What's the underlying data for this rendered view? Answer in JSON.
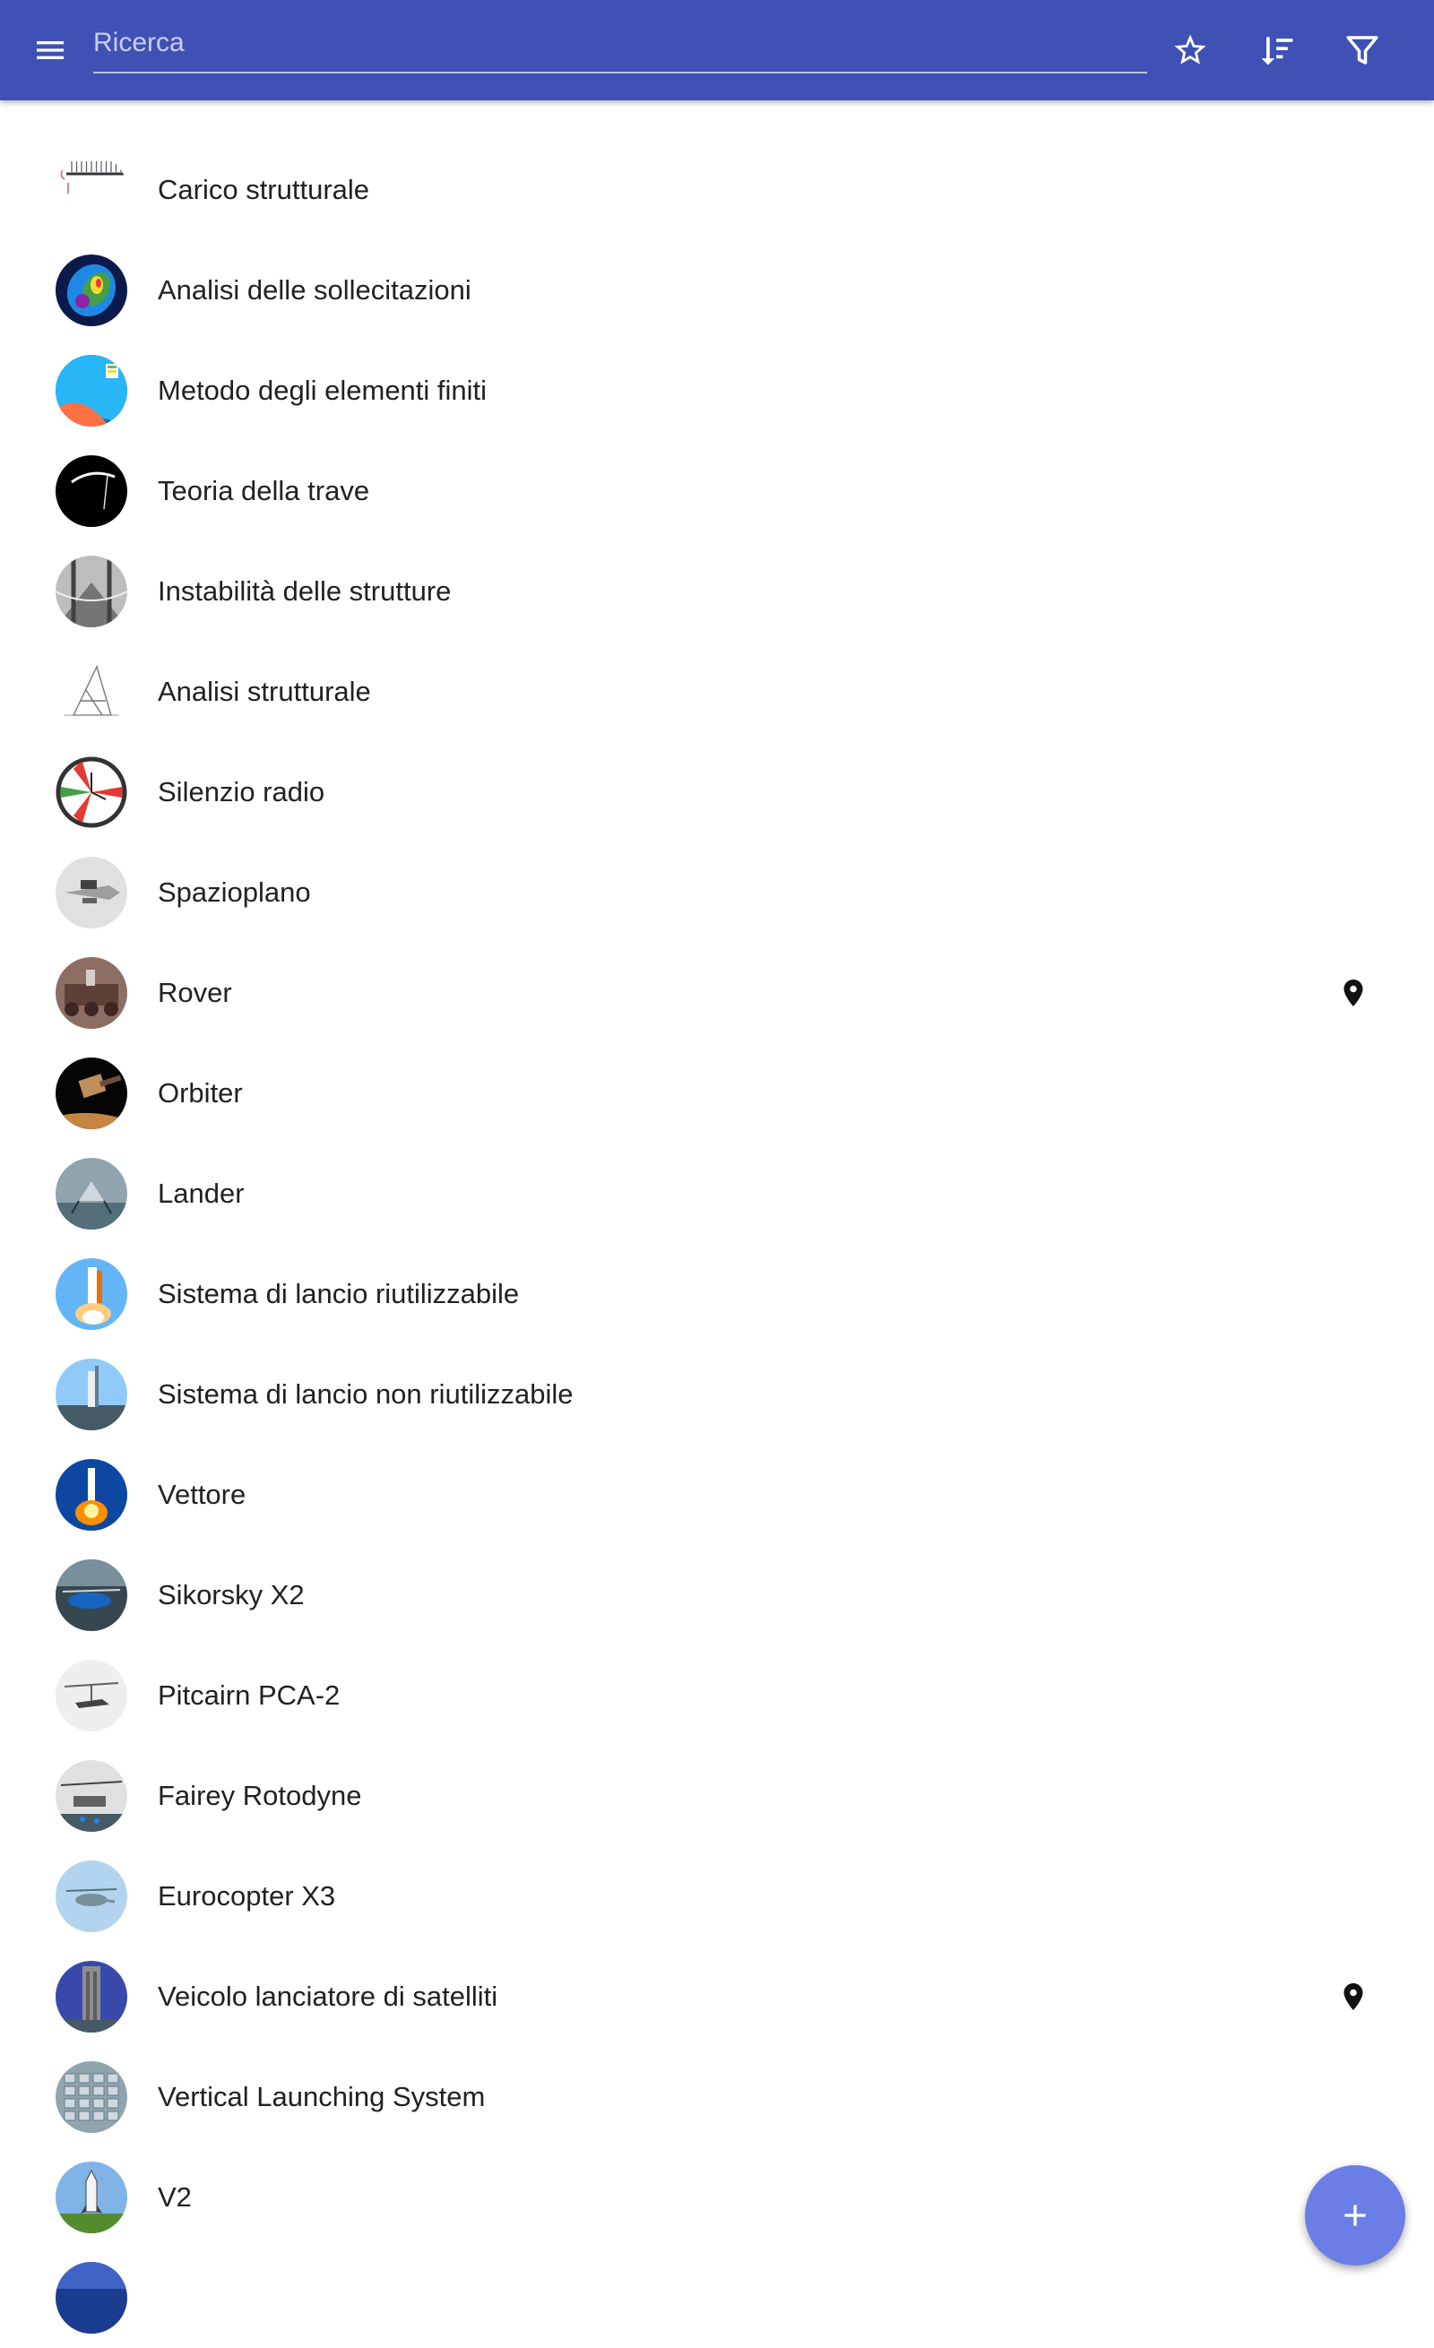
{
  "app_bar": {
    "background": "#3f51b5",
    "menu_icon": "menu-icon",
    "search": {
      "placeholder": "Ricerca",
      "value": ""
    },
    "actions": [
      {
        "icon": "star-outline-icon"
      },
      {
        "icon": "sort-icon"
      },
      {
        "icon": "filter-icon"
      }
    ]
  },
  "list": {
    "items": [
      {
        "label": "Carico strutturale",
        "thumb": "beam-load-diagram",
        "pin": false
      },
      {
        "label": "Analisi delle sollecitazioni",
        "thumb": "stress-colormap",
        "pin": false
      },
      {
        "label": "Metodo degli elementi finiti",
        "thumb": "fem-mesh",
        "pin": false
      },
      {
        "label": "Teoria della trave",
        "thumb": "beam-dark",
        "pin": false
      },
      {
        "label": "Instabilità delle strutture",
        "thumb": "bridge-photo",
        "pin": false
      },
      {
        "label": "Analisi strutturale",
        "thumb": "truss-drawing",
        "pin": false
      },
      {
        "label": "Silenzio radio",
        "thumb": "radio-clock",
        "pin": false
      },
      {
        "label": "Spazioplano",
        "thumb": "spaceplane",
        "pin": false
      },
      {
        "label": "Rover",
        "thumb": "rover-photo",
        "pin": true
      },
      {
        "label": "Orbiter",
        "thumb": "orbiter-photo",
        "pin": false
      },
      {
        "label": "Lander",
        "thumb": "lander-photo",
        "pin": false
      },
      {
        "label": "Sistema di lancio riutilizzabile",
        "thumb": "shuttle-launch",
        "pin": false
      },
      {
        "label": "Sistema di lancio non riutilizzabile",
        "thumb": "rocket-pad",
        "pin": false
      },
      {
        "label": "Vettore",
        "thumb": "rocket-liftoff",
        "pin": false
      },
      {
        "label": "Sikorsky X2",
        "thumb": "helicopter-hangar",
        "pin": false
      },
      {
        "label": "Pitcairn PCA-2",
        "thumb": "autogyro-bw",
        "pin": false
      },
      {
        "label": "Fairey Rotodyne",
        "thumb": "rotodyne-bw",
        "pin": false
      },
      {
        "label": "Eurocopter X3",
        "thumb": "helicopter-sky",
        "pin": false
      },
      {
        "label": "Veicolo lanciatore di satelliti",
        "thumb": "launch-tower",
        "pin": true
      },
      {
        "label": "Vertical Launching System",
        "thumb": "ship-deck",
        "pin": false
      },
      {
        "label": "V2",
        "thumb": "v2-rocket",
        "pin": false
      },
      {
        "label": "",
        "thumb": "partial-blue",
        "pin": false
      }
    ]
  },
  "fab": {
    "icon": "plus-icon",
    "color": "#6b7ee6"
  }
}
